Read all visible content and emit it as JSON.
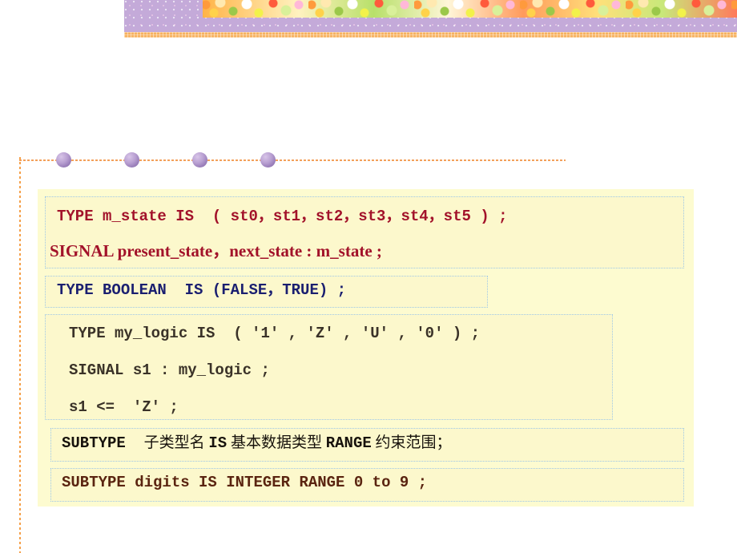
{
  "slide": {
    "background_color": "#ffffff",
    "header": {
      "purple_band_color": "#c4aad9",
      "orange_bar_color": "#f7b15e",
      "photo_strip_label": "decorative-photo-strip"
    },
    "divider": {
      "line_color": "#f3a05a",
      "sphere_color": "#9277b4",
      "sphere_count": 4,
      "sphere_positions": [
        55,
        140,
        225,
        310
      ]
    },
    "panel": {
      "background_color": "#fdfbd0",
      "border_color": "#9ec8e8"
    }
  },
  "code_blocks": [
    {
      "id": "type-m-state",
      "text_color": "#a2122a",
      "lines": [
        "TYPE m_state IS  ( st0，st1，st2，st3，st4，st5 ) ;",
        "SIGNAL present_state，next_state : m_state ;"
      ]
    },
    {
      "id": "type-boolean",
      "text_color": "#1a1f70",
      "lines": [
        "TYPE BOOLEAN  IS (FALSE，TRUE) ;"
      ]
    },
    {
      "id": "type-my-logic",
      "text_color": "#3a3228",
      "lines": [
        "TYPE my_logic IS  ( '1' , 'Z' , 'U' , '0' ) ;",
        "SIGNAL s1 : my_logic ;",
        "s1 <=  'Z' ;"
      ]
    },
    {
      "id": "subtype-generic",
      "text_color": "#17120c",
      "segments": [
        {
          "text": "SUBTYPE",
          "style": "keyword"
        },
        {
          "text": "  ",
          "style": "keyword"
        },
        {
          "text": "子类型名",
          "style": "chinese"
        },
        {
          "text": " ",
          "style": "chinese"
        },
        {
          "text": "IS",
          "style": "keyword"
        },
        {
          "text": " ",
          "style": "chinese"
        },
        {
          "text": "基本数据类型",
          "style": "chinese"
        },
        {
          "text": " ",
          "style": "chinese"
        },
        {
          "text": "RANGE",
          "style": "keyword"
        },
        {
          "text": " ",
          "style": "chinese"
        },
        {
          "text": "约束范围；",
          "style": "chinese"
        }
      ],
      "plain_text": "SUBTYPE  子类型名 IS 基本数据类型 RANGE 约束范围；"
    },
    {
      "id": "subtype-digits",
      "text_color": "#5a2410",
      "lines": [
        "SUBTYPE digits IS INTEGER RANGE 0 to 9 ;"
      ]
    }
  ]
}
